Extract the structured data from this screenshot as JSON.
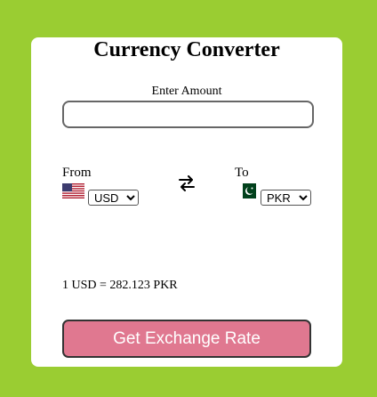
{
  "app": {
    "title": "Currency Converter"
  },
  "amount": {
    "label": "Enter Amount",
    "value": "",
    "placeholder": ""
  },
  "from": {
    "label": "From",
    "flag": "us-flag-icon",
    "selected": "USD",
    "options": [
      "USD"
    ]
  },
  "to": {
    "label": "To",
    "flag": "pk-flag-icon",
    "selected": "PKR",
    "options": [
      "PKR"
    ]
  },
  "swap": {
    "icon": "swap-arrows-icon"
  },
  "result": {
    "rate_text": "1 USD = 282.123 PKR"
  },
  "actions": {
    "get_rate_label": "Get Exchange Rate"
  },
  "colors": {
    "page_background": "#9acd32",
    "card_background": "#ffffff",
    "button_background": "#e07890",
    "button_text": "#ffffff"
  }
}
